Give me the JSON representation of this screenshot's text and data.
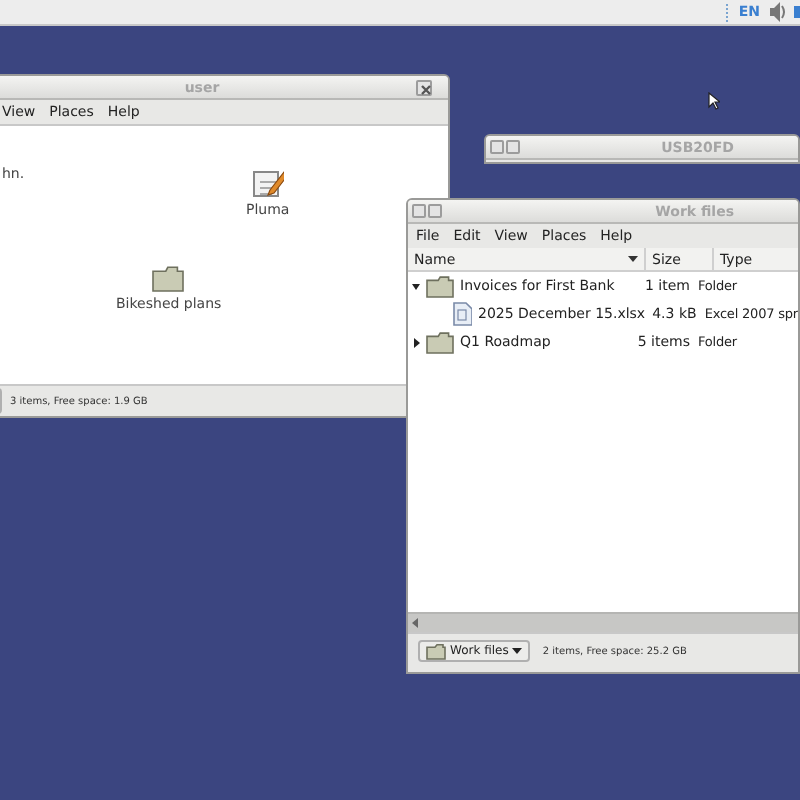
{
  "top_panel": {
    "keyboard_layout": "EN"
  },
  "user_window": {
    "title": "user",
    "menu": [
      "View",
      "Places",
      "Help"
    ],
    "text": "hn.",
    "icons": [
      {
        "kind": "editor",
        "label": "Pluma"
      },
      {
        "kind": "folder",
        "label": "Bikeshed plans"
      }
    ],
    "status": "3 items, Free space: 1.9 GB"
  },
  "usb_window": {
    "title": "USB20FD"
  },
  "work_files_window": {
    "title": "Work files",
    "menu": [
      "File",
      "Edit",
      "View",
      "Places",
      "Help"
    ],
    "columns": [
      "Name",
      "Size",
      "Type"
    ],
    "rows": [
      {
        "kind": "folder",
        "name": "Invoices for First Bank",
        "size": "1 item",
        "type": "Folder",
        "expanded": true,
        "children": [
          {
            "kind": "spreadsheet",
            "name": "2025 December 15.xlsx",
            "size": "4.3 kB",
            "type": "Excel 2007 spr"
          }
        ]
      },
      {
        "kind": "folder",
        "name": "Q1 Roadmap",
        "size": "5 items",
        "type": "Folder",
        "expanded": false
      }
    ],
    "location": "Work files",
    "status": "2 items, Free space: 25.2 GB"
  }
}
